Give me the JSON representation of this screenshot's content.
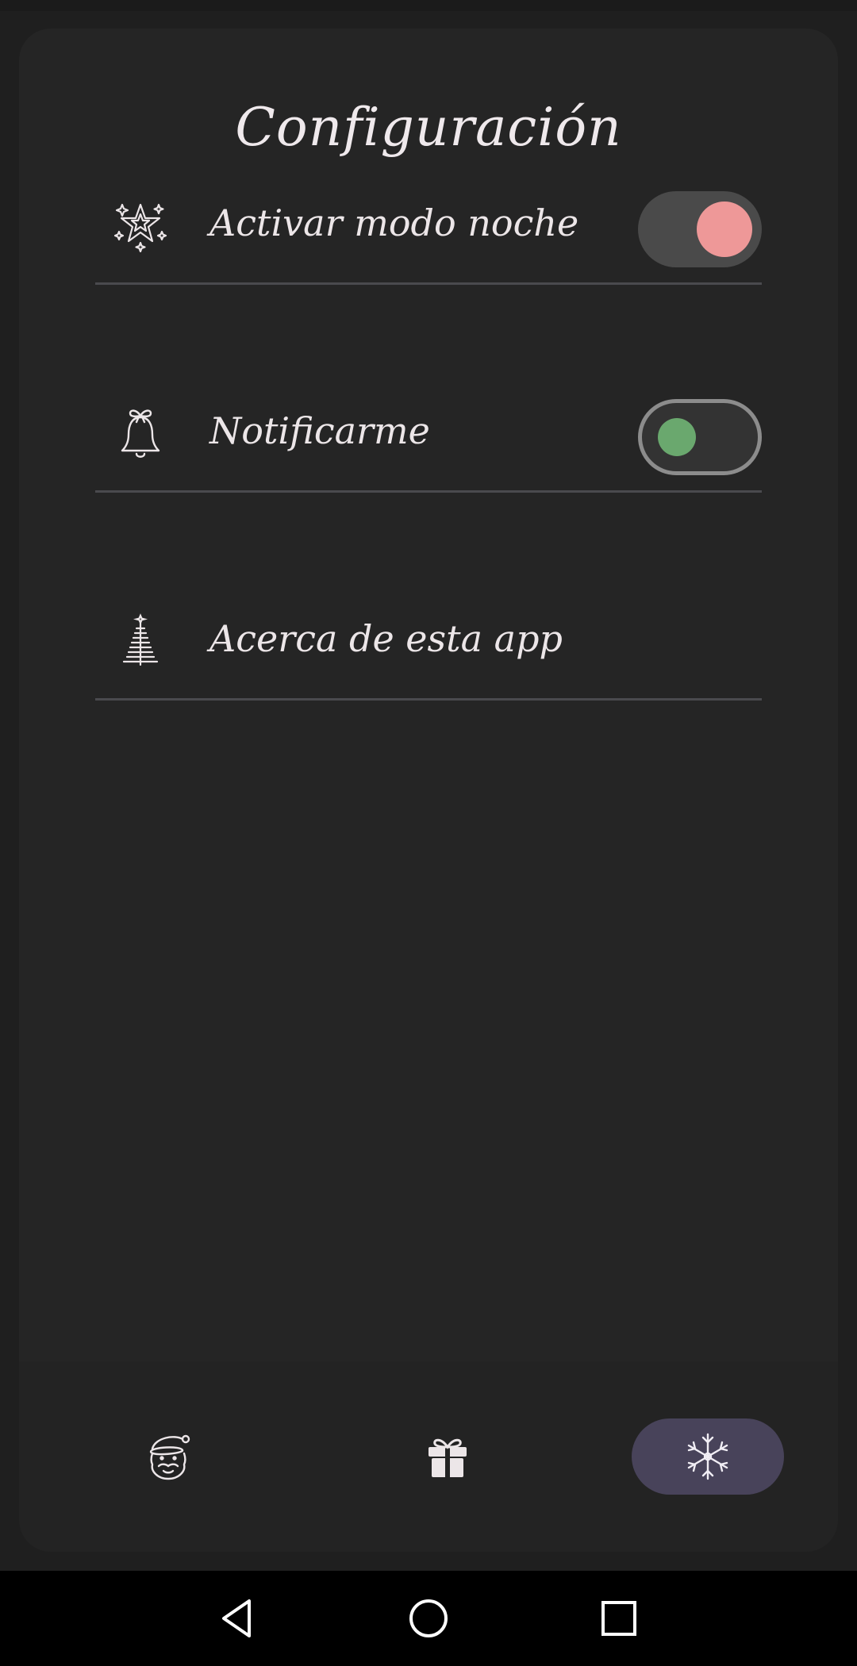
{
  "page": {
    "title": "Configuración"
  },
  "settings": [
    {
      "icon": "star-icon",
      "label": "Activar modo noche",
      "toggle": true,
      "toggle_state": "on"
    },
    {
      "icon": "bell-icon",
      "label": "Notificarme",
      "toggle": true,
      "toggle_state": "off"
    },
    {
      "icon": "christmas-tree-icon",
      "label": "Acerca de esta app",
      "toggle": false
    }
  ],
  "bottom_nav": [
    {
      "icon": "santa-icon",
      "selected": false
    },
    {
      "icon": "gift-icon",
      "selected": false
    },
    {
      "icon": "snowflake-icon",
      "selected": true
    }
  ],
  "system_nav": [
    "back-icon",
    "home-icon",
    "recent-apps-icon"
  ],
  "colors": {
    "background": "#252525",
    "text": "#ece6e8",
    "toggle_on_knob": "#ee9898",
    "toggle_off_knob": "#6aa86e",
    "nav_selected": "#48435a"
  }
}
